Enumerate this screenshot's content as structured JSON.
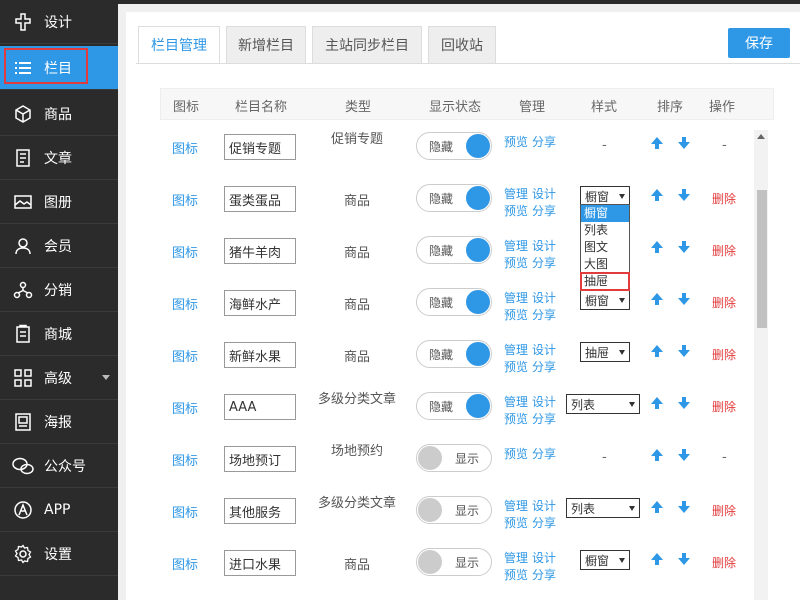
{
  "sidebar": {
    "items": [
      {
        "label": "设计",
        "icon": "design-icon"
      },
      {
        "label": "栏目",
        "icon": "list-icon",
        "active": true
      },
      {
        "label": "商品",
        "icon": "box-icon"
      },
      {
        "label": "文章",
        "icon": "article-icon"
      },
      {
        "label": "图册",
        "icon": "album-icon"
      },
      {
        "label": "会员",
        "icon": "user-icon"
      },
      {
        "label": "分销",
        "icon": "distribution-icon"
      },
      {
        "label": "商城",
        "icon": "mall-icon"
      },
      {
        "label": "高级",
        "icon": "grid-icon"
      },
      {
        "label": "海报",
        "icon": "poster-icon"
      },
      {
        "label": "公众号",
        "icon": "wechat-icon"
      },
      {
        "label": "APP",
        "icon": "app-icon"
      },
      {
        "label": "设置",
        "icon": "gear-icon"
      }
    ]
  },
  "tabs": [
    {
      "label": "栏目管理",
      "active": true
    },
    {
      "label": "新增栏目"
    },
    {
      "label": "主站同步栏目"
    },
    {
      "label": "回收站"
    }
  ],
  "save_label": "保存",
  "table": {
    "headers": [
      "图标",
      "栏目名称",
      "类型",
      "显示状态",
      "管理",
      "样式",
      "排序",
      "操作"
    ],
    "icon_link": "图标",
    "hidden_label": "隐藏",
    "shown_label": "显示",
    "delete_label": "删除",
    "manage_label": "管理",
    "design_label": "设计",
    "preview_label": "预览",
    "share_label": "分享",
    "rows": [
      {
        "name": "促销专题",
        "type": "促销专题",
        "status": "hidden",
        "manage": [
          "预览",
          "分享"
        ],
        "style": "-",
        "delete": "-"
      },
      {
        "name": "蛋类蛋品",
        "type": "商品",
        "status": "hidden",
        "manage": [
          "管理",
          "设计",
          "预览",
          "分享"
        ],
        "style": "橱窗",
        "delete": "删除"
      },
      {
        "name": "猪牛羊肉",
        "type": "商品",
        "status": "hidden",
        "manage": [
          "管理",
          "设计",
          "预览",
          "分享"
        ],
        "style": "",
        "delete": "删除"
      },
      {
        "name": "海鲜水产",
        "type": "商品",
        "status": "hidden",
        "manage": [
          "管理",
          "设计",
          "预览",
          "分享"
        ],
        "style": "橱窗",
        "delete": "删除"
      },
      {
        "name": "新鲜水果",
        "type": "商品",
        "status": "hidden",
        "manage": [
          "管理",
          "设计",
          "预览",
          "分享"
        ],
        "style": "抽屉",
        "delete": "删除"
      },
      {
        "name": "AAA",
        "type": "多级分类文章",
        "status": "hidden",
        "manage": [
          "管理",
          "设计",
          "预览",
          "分享"
        ],
        "style": "列表",
        "delete": "删除"
      },
      {
        "name": "场地预订",
        "type": "场地预约",
        "status": "shown",
        "manage": [
          "预览",
          "分享"
        ],
        "style": "-",
        "delete": "-"
      },
      {
        "name": "其他服务",
        "type": "多级分类文章",
        "status": "shown",
        "manage": [
          "管理",
          "设计",
          "预览",
          "分享"
        ],
        "style": "列表",
        "delete": "删除"
      },
      {
        "name": "进口水果",
        "type": "商品",
        "status": "shown",
        "manage": [
          "管理",
          "设计",
          "预览",
          "分享"
        ],
        "style": "橱窗",
        "delete": "删除"
      }
    ]
  },
  "dropdown_options": [
    "橱窗",
    "列表",
    "图文",
    "大图",
    "抽屉"
  ],
  "colors": {
    "accent": "#2e97e6",
    "danger": "#e23b3b",
    "sidebar": "#2b2b2b"
  }
}
